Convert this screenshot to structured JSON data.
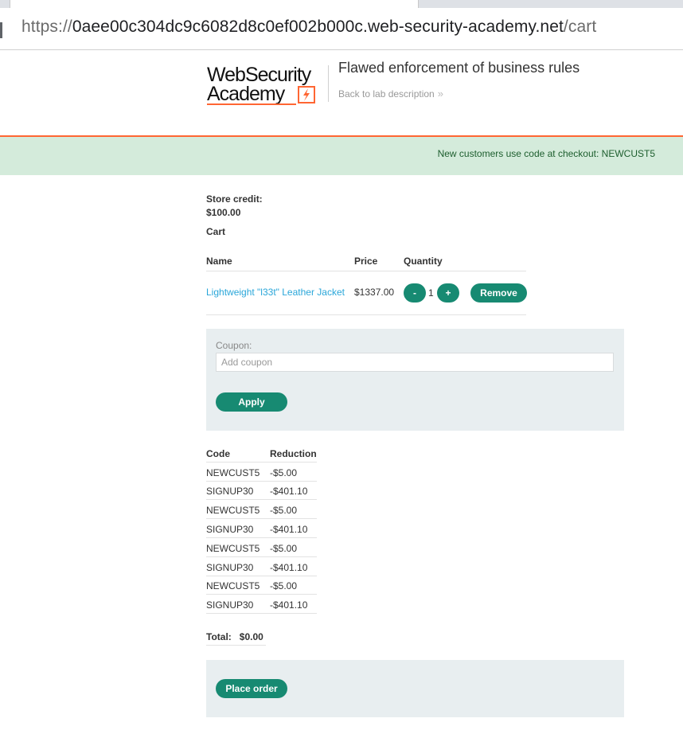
{
  "browser": {
    "url_prefix": "https://",
    "url_host": "0aee00c304dc9c6082d8c0ef002b000c.web-security-academy.net",
    "url_path": "/cart"
  },
  "header": {
    "logo_line1": "WebSecurity",
    "logo_line2": "Academy",
    "lab_title": "Flawed enforcement of business rules",
    "back_link": "Back to lab description",
    "back_icon": "double-chevron-right-icon"
  },
  "notice": "New customers use code at checkout: NEWCUST5",
  "store_credit": {
    "label": "Store credit:",
    "value": "$100.00"
  },
  "cart": {
    "heading": "Cart",
    "columns": [
      "Name",
      "Price",
      "Quantity"
    ],
    "items": [
      {
        "name": "Lightweight \"l33t\" Leather Jacket",
        "price": "$1337.00",
        "decrement": "-",
        "quantity": "1",
        "increment": "+",
        "remove": "Remove"
      }
    ]
  },
  "coupon": {
    "label": "Coupon:",
    "placeholder": "Add coupon",
    "apply": "Apply"
  },
  "reductions": {
    "columns": [
      "Code",
      "Reduction"
    ],
    "rows": [
      {
        "code": "NEWCUST5",
        "reduction": "-$5.00"
      },
      {
        "code": "SIGNUP30",
        "reduction": "-$401.10"
      },
      {
        "code": "NEWCUST5",
        "reduction": "-$5.00"
      },
      {
        "code": "SIGNUP30",
        "reduction": "-$401.10"
      },
      {
        "code": "NEWCUST5",
        "reduction": "-$5.00"
      },
      {
        "code": "SIGNUP30",
        "reduction": "-$401.10"
      },
      {
        "code": "NEWCUST5",
        "reduction": "-$5.00"
      },
      {
        "code": "SIGNUP30",
        "reduction": "-$401.10"
      }
    ]
  },
  "total": {
    "label": "Total:",
    "value": "$0.00"
  },
  "place_order": "Place order",
  "colors": {
    "accent": "#178a72",
    "brand_orange": "#ff6633",
    "link": "#29a6d9",
    "notice_bg": "#d4ebdb",
    "panel_bg": "#e8eef0"
  }
}
